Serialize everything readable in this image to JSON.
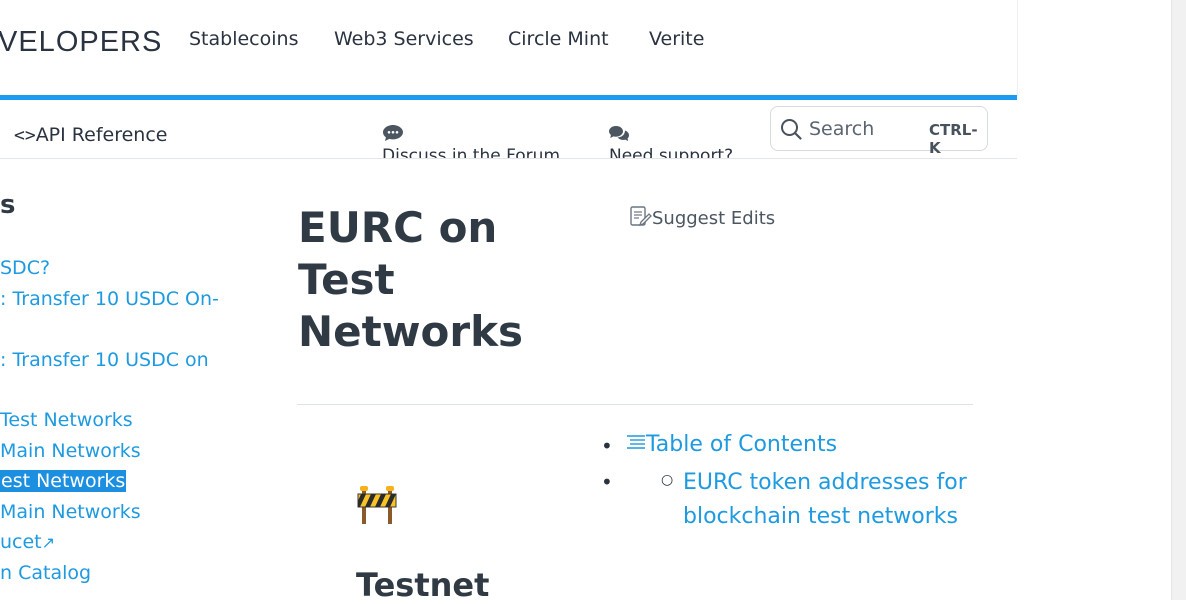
{
  "header": {
    "brand": "VELOPERS",
    "nav": [
      "Stablecoins",
      "Web3 Services",
      "Circle Mint",
      "Verite"
    ]
  },
  "subbar": {
    "api_reference": "API Reference",
    "forum": "Discuss in the Forum",
    "support": "Need support?"
  },
  "search": {
    "placeholder": "Search",
    "shortcut": "CTRL-K"
  },
  "sidebar": {
    "heading": "s",
    "items": [
      "SDC?",
      ": Transfer 10 USDC On-",
      ": Transfer 10 USDC on",
      "Test Networks",
      "Main Networks",
      "est Networks",
      "Main Networks",
      "ucet",
      "n Catalog"
    ]
  },
  "page": {
    "title": "EURC on Test Networks",
    "suggest_edits": "Suggest Edits",
    "toc_title": "Table of Contents",
    "toc_sub": "EURC token addresses for blockchain test networks",
    "section_heading": "Testnet"
  },
  "colors": {
    "accent": "#1d9bf0",
    "link": "#1e9ae0"
  }
}
